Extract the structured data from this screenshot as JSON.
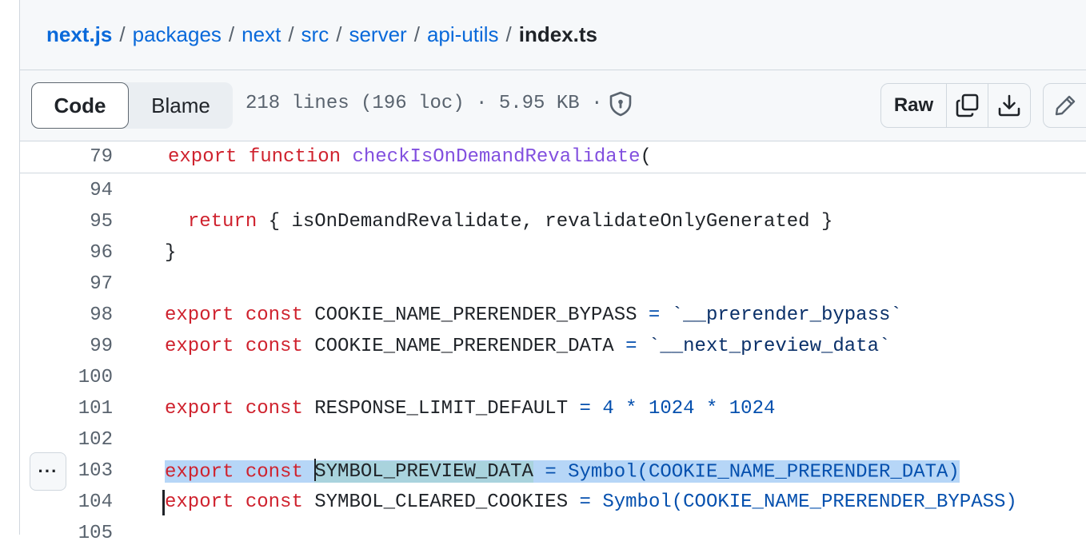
{
  "breadcrumb": {
    "items": [
      "next.js",
      "packages",
      "next",
      "src",
      "server",
      "api-utils"
    ],
    "separator": "/",
    "current": "index.ts"
  },
  "file_header": {
    "tabs": {
      "code": "Code",
      "blame": "Blame"
    },
    "meta": "218 lines (196 loc) · 5.95 KB ·",
    "raw_label": "Raw",
    "icons": [
      "shield-icon",
      "copy-icon",
      "download-icon",
      "pencil-icon"
    ]
  },
  "sticky": {
    "line_number": "79",
    "tokens": {
      "kw1": "export",
      "kw2": "function",
      "fn": "checkIsOnDemandRevalidate",
      "rest": "("
    }
  },
  "lines": {
    "l94": {
      "n": "94"
    },
    "l95": {
      "n": "95",
      "indent": "  ",
      "kw": "return",
      "rest": " { isOnDemandRevalidate, revalidateOnlyGenerated }"
    },
    "l96": {
      "n": "96",
      "text": "}"
    },
    "l97": {
      "n": "97"
    },
    "l98": {
      "n": "98",
      "kw1": "export",
      "kw2": "const",
      "id": "COOKIE_NAME_PRERENDER_BYPASS",
      "op": "=",
      "str": "`__prerender_bypass`"
    },
    "l99": {
      "n": "99",
      "kw1": "export",
      "kw2": "const",
      "id": "COOKIE_NAME_PRERENDER_DATA",
      "op": "=",
      "str": "`__next_preview_data`"
    },
    "l100": {
      "n": "100"
    },
    "l101": {
      "n": "101",
      "kw1": "export",
      "kw2": "const",
      "id": "RESPONSE_LIMIT_DEFAULT",
      "op": "=",
      "n1": "4",
      "op2": "*",
      "n2": "1024",
      "op3": "*",
      "n3": "1024"
    },
    "l102": {
      "n": "102"
    },
    "l103": {
      "n": "103",
      "kw1": "export",
      "kw2": "const",
      "id": "SYMBOL_PREVIEW_DATA",
      "op": "=",
      "rest": "Symbol(COOKIE_NAME_PRERENDER_DATA)"
    },
    "l104": {
      "n": "104",
      "kw1": "export",
      "kw2": "const",
      "id": "SYMBOL_CLEARED_COOKIES",
      "op": "=",
      "rest": "Symbol(COOKIE_NAME_PRERENDER_BYPASS)"
    },
    "l105": {
      "n": "105"
    }
  },
  "more_button_label": "···",
  "colors": {
    "keyword": "#cf222e",
    "function": "#8250df",
    "string": "#0a3069",
    "operator": "#0550ae",
    "link": "#0969da",
    "selection": "#b6d6f7"
  }
}
